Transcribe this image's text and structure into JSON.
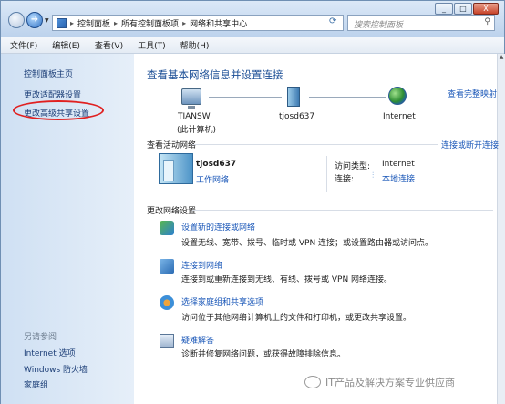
{
  "address": {
    "parts": [
      "控制面板",
      "所有控制面板项",
      "网络和共享中心"
    ]
  },
  "search": {
    "placeholder": "搜索控制面板"
  },
  "window_controls": {
    "minimize": "_",
    "maximize": "□",
    "close": "X"
  },
  "menu": [
    "文件(F)",
    "编辑(E)",
    "查看(V)",
    "工具(T)",
    "帮助(H)"
  ],
  "left": {
    "links": [
      "控制面板主页",
      "更改适配器设置",
      "更改高级共享设置"
    ],
    "see_also_header": "另请参阅",
    "see_also": [
      "Internet 选项",
      "Windows 防火墙",
      "家庭组"
    ]
  },
  "main": {
    "heading": "查看基本网络信息并设置连接",
    "full_map_link": "查看完整映射",
    "map": {
      "computer": "TIANSW",
      "computer_sub": "(此计算机)",
      "network": "tjosd637",
      "internet": "Internet"
    },
    "active_header": "查看活动网络",
    "connect_link": "连接或断开连接",
    "network_name": "tjosd637",
    "network_type": "工作网络",
    "access_label": "访问类型:",
    "access_value": "Internet",
    "conn_label": "连接:",
    "conn_value": "本地连接",
    "change_header": "更改网络设置",
    "tasks": [
      {
        "title": "设置新的连接或网络",
        "desc": "设置无线、宽带、拨号、临时或 VPN 连接；或设置路由器或访问点。"
      },
      {
        "title": "连接到网络",
        "desc": "连接到或重新连接到无线、有线、拨号或 VPN 网络连接。"
      },
      {
        "title": "选择家庭组和共享选项",
        "desc": "访问位于其他网络计算机上的文件和打印机，或更改共享设置。"
      },
      {
        "title": "疑难解答",
        "desc": "诊断并修复网络问题，或获得故障排除信息。"
      }
    ]
  },
  "watermark": "IT产品及解决方案专业供应商"
}
